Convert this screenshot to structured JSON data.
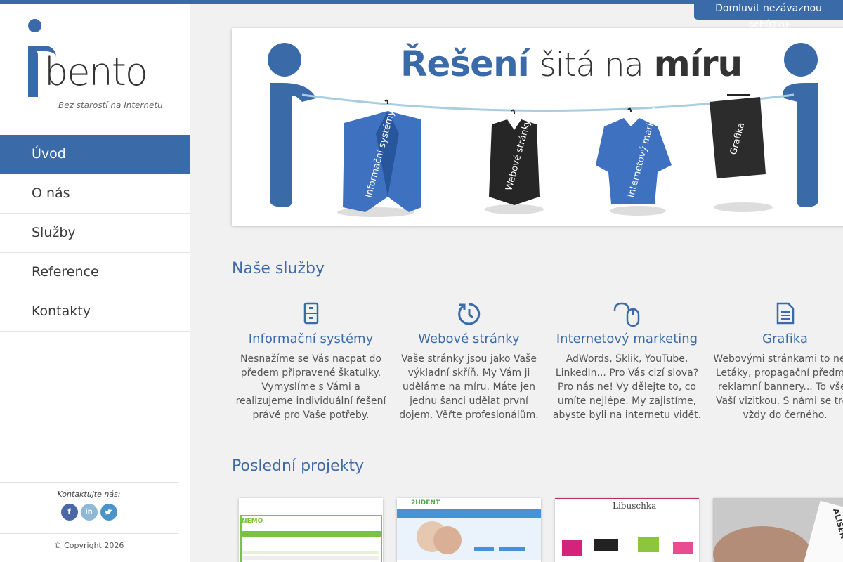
{
  "cta": {
    "label": "Domluvit nezávaznou schůzku"
  },
  "logo": {
    "word": "bento",
    "tagline": "Bez starostí na Internetu"
  },
  "nav": {
    "items": [
      {
        "label": "Úvod",
        "active": true
      },
      {
        "label": "O nás",
        "active": false
      },
      {
        "label": "Služby",
        "active": false
      },
      {
        "label": "Reference",
        "active": false
      },
      {
        "label": "Kontakty",
        "active": false
      }
    ]
  },
  "sidebar_footer": {
    "contact_label": "Kontaktujte nás:",
    "socials": [
      "facebook-icon",
      "linkedin-icon",
      "twitter-icon"
    ],
    "copyright": "© Copyright 2026"
  },
  "banner": {
    "title_part1": "Řešení",
    "title_part2": "šitá na",
    "title_part3": "míru",
    "garments": [
      {
        "label": "Informační systémy"
      },
      {
        "label": "Webové stránky"
      },
      {
        "label": "Internetový marketing"
      },
      {
        "label": "Grafika"
      }
    ]
  },
  "services_section": {
    "title": "Naše služby",
    "items": [
      {
        "icon": "cabinet-icon",
        "title": "Informační systémy",
        "description": "Nesnažíme se Vás nacpat do předem připravené škatulky. Vymyslíme s Vámi a realizujeme individuální řešení právě pro Vaše potřeby."
      },
      {
        "icon": "refresh-icon",
        "title": "Webové stránky",
        "description": "Vaše stránky jsou jako Vaše výkladní skříň. My Vám ji uděláme na míru. Máte jen jednu šanci udělat první dojem. Věřte profesionálům."
      },
      {
        "icon": "mouse-icon",
        "title": "Internetový marketing",
        "description": "AdWords, Sklik, YouTube, LinkedIn... Pro Vás cizí slova? Pro nás ne! Vy dělejte to, co umíte nejlépe. My zajistíme, abyste byli na internetu vidět."
      },
      {
        "icon": "document-icon",
        "title": "Grafika",
        "description": "Webovými stránkami to neko Letáky, propagační předmět reklamní bannery... To vše j Vaší vizitkou. S námi se trefí vždy do černého."
      }
    ]
  },
  "projects_section": {
    "title": "Poslední projekty",
    "items": [
      {
        "name": "NEMO"
      },
      {
        "name": "2HDENT"
      },
      {
        "name": "Libuschka"
      },
      {
        "name": "ALISEN"
      }
    ]
  },
  "colors": {
    "accent": "#3b6aa8",
    "background": "#f1f1f1"
  }
}
